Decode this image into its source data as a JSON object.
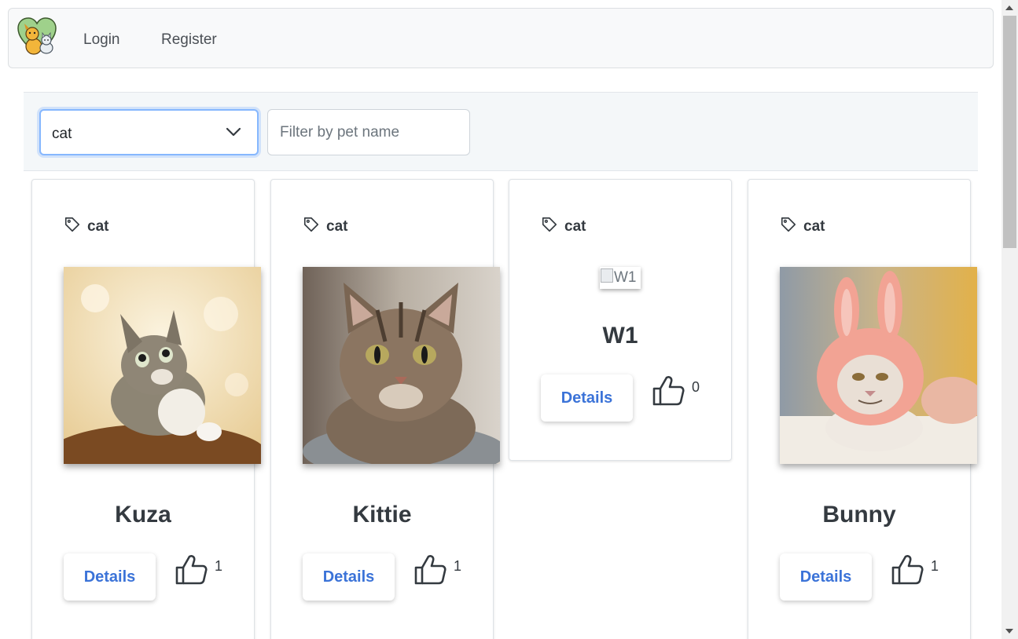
{
  "nav": {
    "logo_alt": "pets logo",
    "links": [
      "Login",
      "Register"
    ]
  },
  "filters": {
    "type_selected": "cat",
    "name_placeholder": "Filter by pet name",
    "name_value": ""
  },
  "pets": [
    {
      "type": "cat",
      "name": "Kuza",
      "details_label": "Details",
      "likes": "1",
      "image": "kitten-looking-up"
    },
    {
      "type": "cat",
      "name": "Kittie",
      "details_label": "Details",
      "likes": "1",
      "image": "tabby-cat-portrait"
    },
    {
      "type": "cat",
      "name": "W1",
      "details_label": "Details",
      "likes": "0",
      "image_alt": "W1"
    },
    {
      "type": "cat",
      "name": "Bunny",
      "details_label": "Details",
      "likes": "1",
      "image": "cat-in-bunny-hat"
    }
  ],
  "colors": {
    "link_blue": "#3b73d8",
    "focus_border": "#86b7fe",
    "navbar_bg": "#f8f9fa"
  }
}
